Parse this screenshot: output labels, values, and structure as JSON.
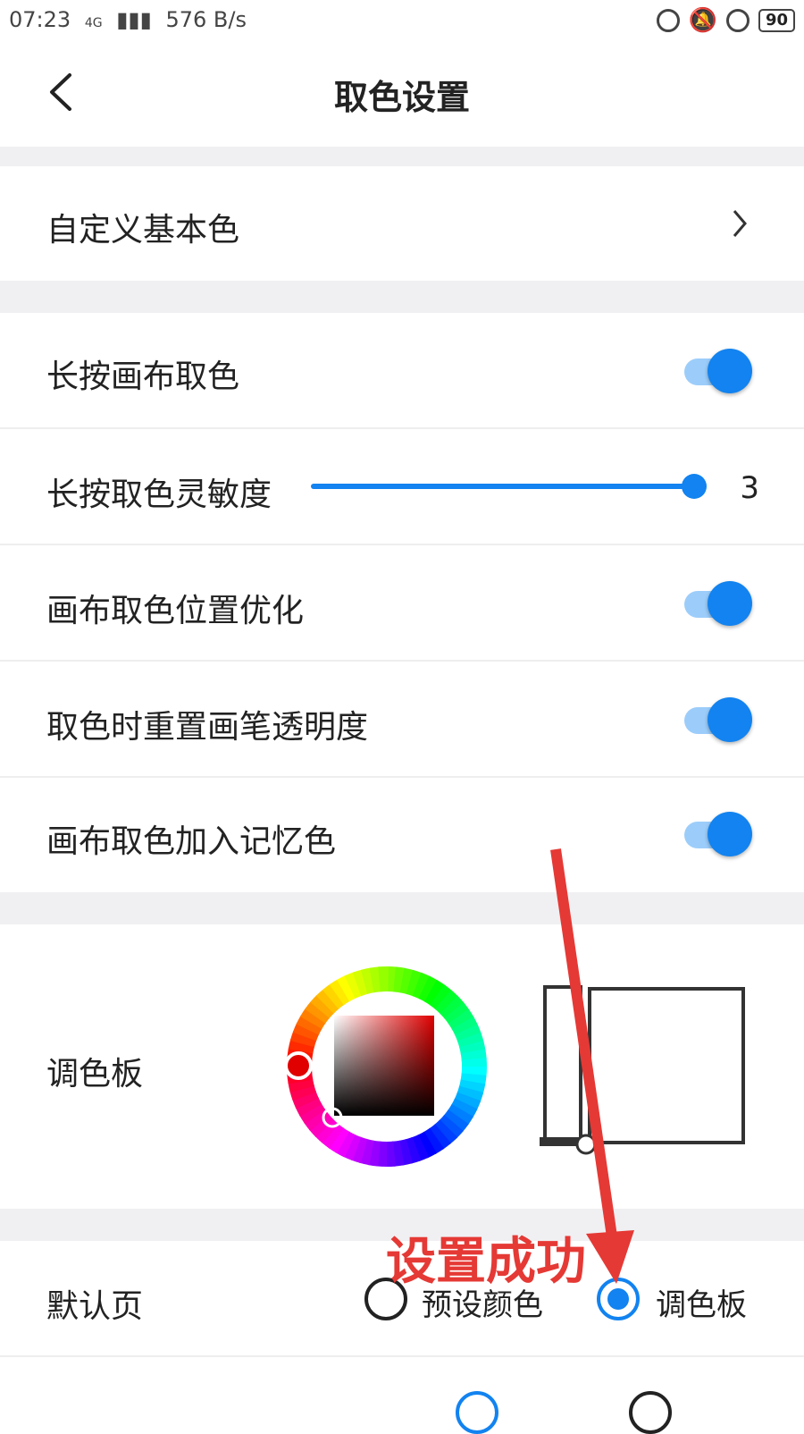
{
  "status_bar": {
    "time": "07:23",
    "network": "4G",
    "speed": "576 B/s",
    "battery": "90"
  },
  "header": {
    "title": "取色设置"
  },
  "rows": {
    "custom_colors": "自定义基本色",
    "long_press_pick": "长按画布取色",
    "sensitivity": {
      "label": "长按取色灵敏度",
      "value": "3",
      "level": 1.0
    },
    "position_opt": "画布取色位置优化",
    "reset_opacity": "取色时重置画笔透明度",
    "add_memory": "画布取色加入记忆色",
    "palette": "调色板",
    "default_page": {
      "label": "默认页",
      "option1": "预设颜色",
      "option2": "调色板",
      "selected": "调色板"
    }
  },
  "toggles": {
    "long_press_pick": true,
    "position_opt": true,
    "reset_opacity": true,
    "add_memory": true
  },
  "annotation": "设置成功",
  "colors": {
    "accent": "#1283f0",
    "annotation": "#e53935"
  }
}
